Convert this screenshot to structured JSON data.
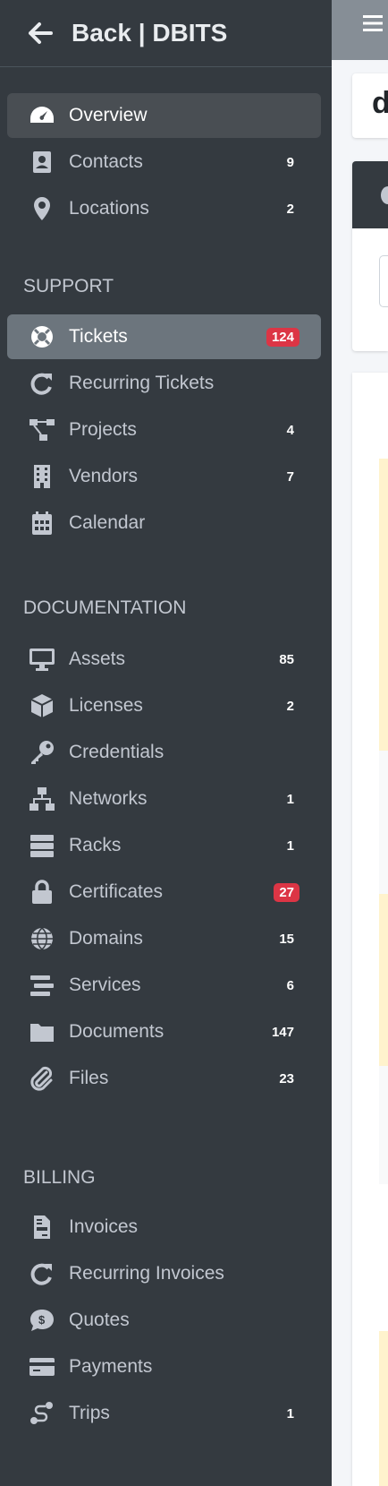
{
  "brand": {
    "title": "Back | DBITS"
  },
  "nav_top": [
    {
      "label": "Overview",
      "icon": "tachometer-icon",
      "count": null
    },
    {
      "label": "Contacts",
      "icon": "address-book-icon",
      "count": "9"
    },
    {
      "label": "Locations",
      "icon": "map-marker-icon",
      "count": "2"
    }
  ],
  "sections": {
    "support": "SUPPORT",
    "documentation": "DOCUMENTATION",
    "billing": "BILLING"
  },
  "nav_support": [
    {
      "label": "Tickets",
      "icon": "life-ring-icon",
      "badge": "124"
    },
    {
      "label": "Recurring Tickets",
      "icon": "redo-icon",
      "count": null
    },
    {
      "label": "Projects",
      "icon": "project-diagram-icon",
      "count": "4"
    },
    {
      "label": "Vendors",
      "icon": "building-icon",
      "count": "7"
    },
    {
      "label": "Calendar",
      "icon": "calendar-icon",
      "count": null
    }
  ],
  "nav_documentation": [
    {
      "label": "Assets",
      "icon": "desktop-icon",
      "count": "85"
    },
    {
      "label": "Licenses",
      "icon": "cube-icon",
      "count": "2"
    },
    {
      "label": "Credentials",
      "icon": "key-icon",
      "count": null
    },
    {
      "label": "Networks",
      "icon": "network-icon",
      "count": "1"
    },
    {
      "label": "Racks",
      "icon": "server-icon",
      "count": "1"
    },
    {
      "label": "Certificates",
      "icon": "lock-icon",
      "badge": "27"
    },
    {
      "label": "Domains",
      "icon": "globe-icon",
      "count": "15"
    },
    {
      "label": "Services",
      "icon": "stream-icon",
      "count": "6"
    },
    {
      "label": "Documents",
      "icon": "folder-icon",
      "count": "147"
    },
    {
      "label": "Files",
      "icon": "paperclip-icon",
      "count": "23"
    }
  ],
  "nav_billing": [
    {
      "label": "Invoices",
      "icon": "file-invoice-icon",
      "count": null
    },
    {
      "label": "Recurring Invoices",
      "icon": "redo-icon",
      "count": null
    },
    {
      "label": "Quotes",
      "icon": "comment-dollar-icon",
      "count": null
    },
    {
      "label": "Payments",
      "icon": "credit-card-icon",
      "count": null
    },
    {
      "label": "Trips",
      "icon": "route-icon",
      "count": "1"
    }
  ],
  "main": {
    "page_title_partial": "d"
  }
}
